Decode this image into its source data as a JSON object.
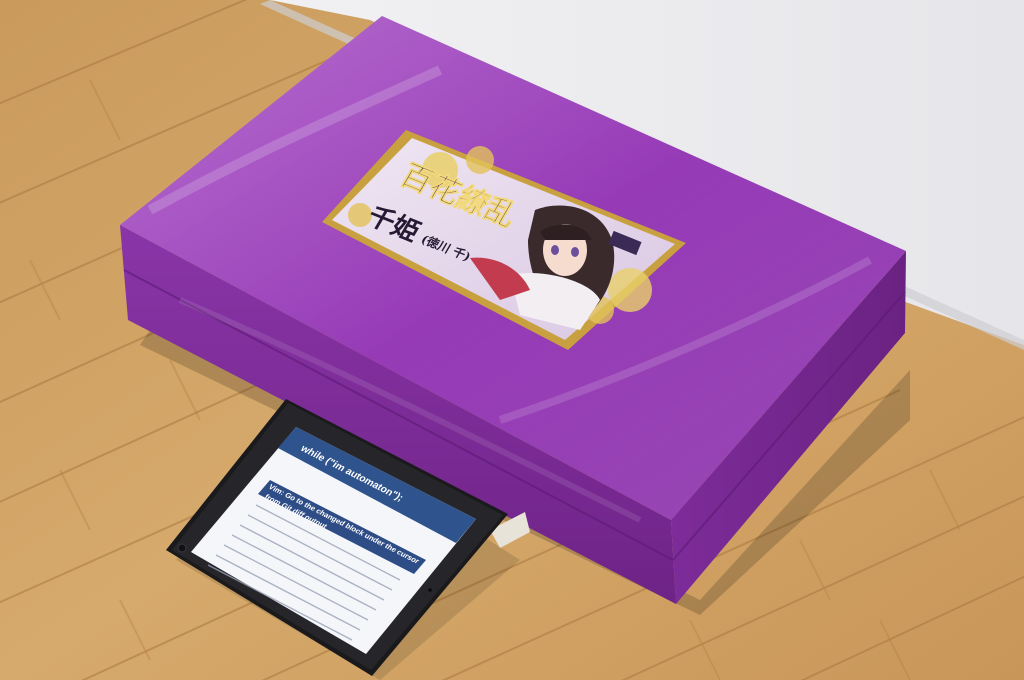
{
  "photo": {
    "colors": {
      "floor": "#d2a466",
      "floor_dark": "#b9874a",
      "wall": "#eeeef0",
      "box_top": "#9a3db9",
      "box_side": "#7a2a98",
      "ipad_frame": "#1b1b1d",
      "ipad_header": "#2b4f86"
    },
    "box_label": {
      "title": "百花繚乱",
      "name": "千姫",
      "name_suffix": "(徳川 千)"
    },
    "tablet_screen": {
      "blog_title": "while (\"im automaton\");",
      "post_title_line1": "Vim: Go to the changed block under the cursor",
      "post_title_line2": "from Git diff output"
    }
  }
}
